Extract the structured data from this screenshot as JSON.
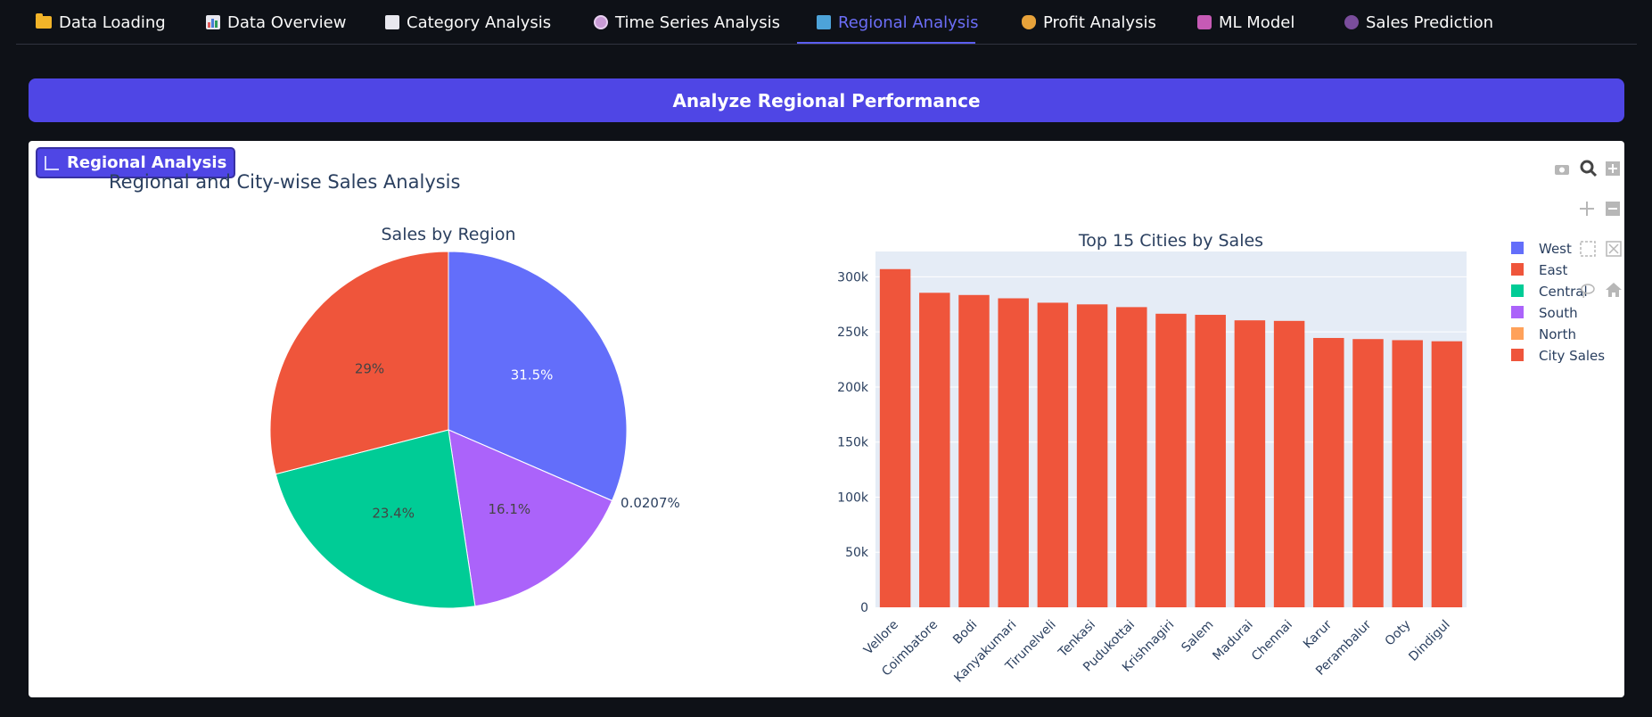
{
  "tabs": [
    {
      "label": "Data Loading",
      "icon": "folder-icon",
      "active": false
    },
    {
      "label": "Data Overview",
      "icon": "bar-chart-icon",
      "active": false
    },
    {
      "label": "Category Analysis",
      "icon": "chart-increasing-icon",
      "active": false
    },
    {
      "label": "Time Series Analysis",
      "icon": "alarm-clock-icon",
      "active": false
    },
    {
      "label": "Regional Analysis",
      "icon": "world-map-icon",
      "active": true
    },
    {
      "label": "Profit Analysis",
      "icon": "money-bag-icon",
      "active": false
    },
    {
      "label": "ML Model",
      "icon": "robot-icon",
      "active": false
    },
    {
      "label": "Sales Prediction",
      "icon": "crystal-ball-icon",
      "active": false
    }
  ],
  "banner": {
    "title": "Analyze Regional Performance"
  },
  "badge": {
    "label": "Regional Analysis",
    "icon": "chart-icon"
  },
  "colors": {
    "accent": "#4f46e5",
    "background": "#0e1117",
    "active_tab": "#6c6ef7"
  },
  "chart_data": [
    {
      "type": "pie",
      "figure_title": "Regional and City-wise Sales Analysis",
      "title": "Sales by Region",
      "labels": [
        "West",
        "East",
        "Central",
        "South",
        "North"
      ],
      "values": [
        31.5,
        29,
        23.4,
        16.1,
        0.0207
      ],
      "value_labels": [
        "31.5%",
        "29%",
        "23.4%",
        "16.1%",
        "0.0207%"
      ],
      "colors": [
        "#636efa",
        "#ef553b",
        "#00cc96",
        "#ab63fa",
        "#ffa15a"
      ]
    },
    {
      "type": "bar",
      "title": "Top 15 Cities by Sales",
      "series": [
        {
          "name": "City Sales",
          "color": "#ef553b"
        }
      ],
      "categories": [
        "Vellore",
        "Coimbatore",
        "Bodi",
        "Kanyakumari",
        "Tirunelveli",
        "Tenkasi",
        "Pudukottai",
        "Krishnagiri",
        "Salem",
        "Madurai",
        "Chennai",
        "Karur",
        "Perambalur",
        "Ooty",
        "Dindigul"
      ],
      "values": [
        307000,
        285500,
        283500,
        280500,
        276500,
        275000,
        272500,
        266500,
        265500,
        260500,
        260000,
        244500,
        243500,
        242500,
        241500
      ],
      "yticks": [
        0,
        50000,
        100000,
        150000,
        200000,
        250000,
        300000
      ],
      "ytick_labels": [
        "0",
        "50k",
        "100k",
        "150k",
        "200k",
        "250k",
        "300k"
      ],
      "ylim": [
        0,
        323000
      ],
      "grid": true,
      "legend_position": "right",
      "legend": [
        "West",
        "East",
        "Central",
        "South",
        "North",
        "City Sales"
      ]
    }
  ]
}
